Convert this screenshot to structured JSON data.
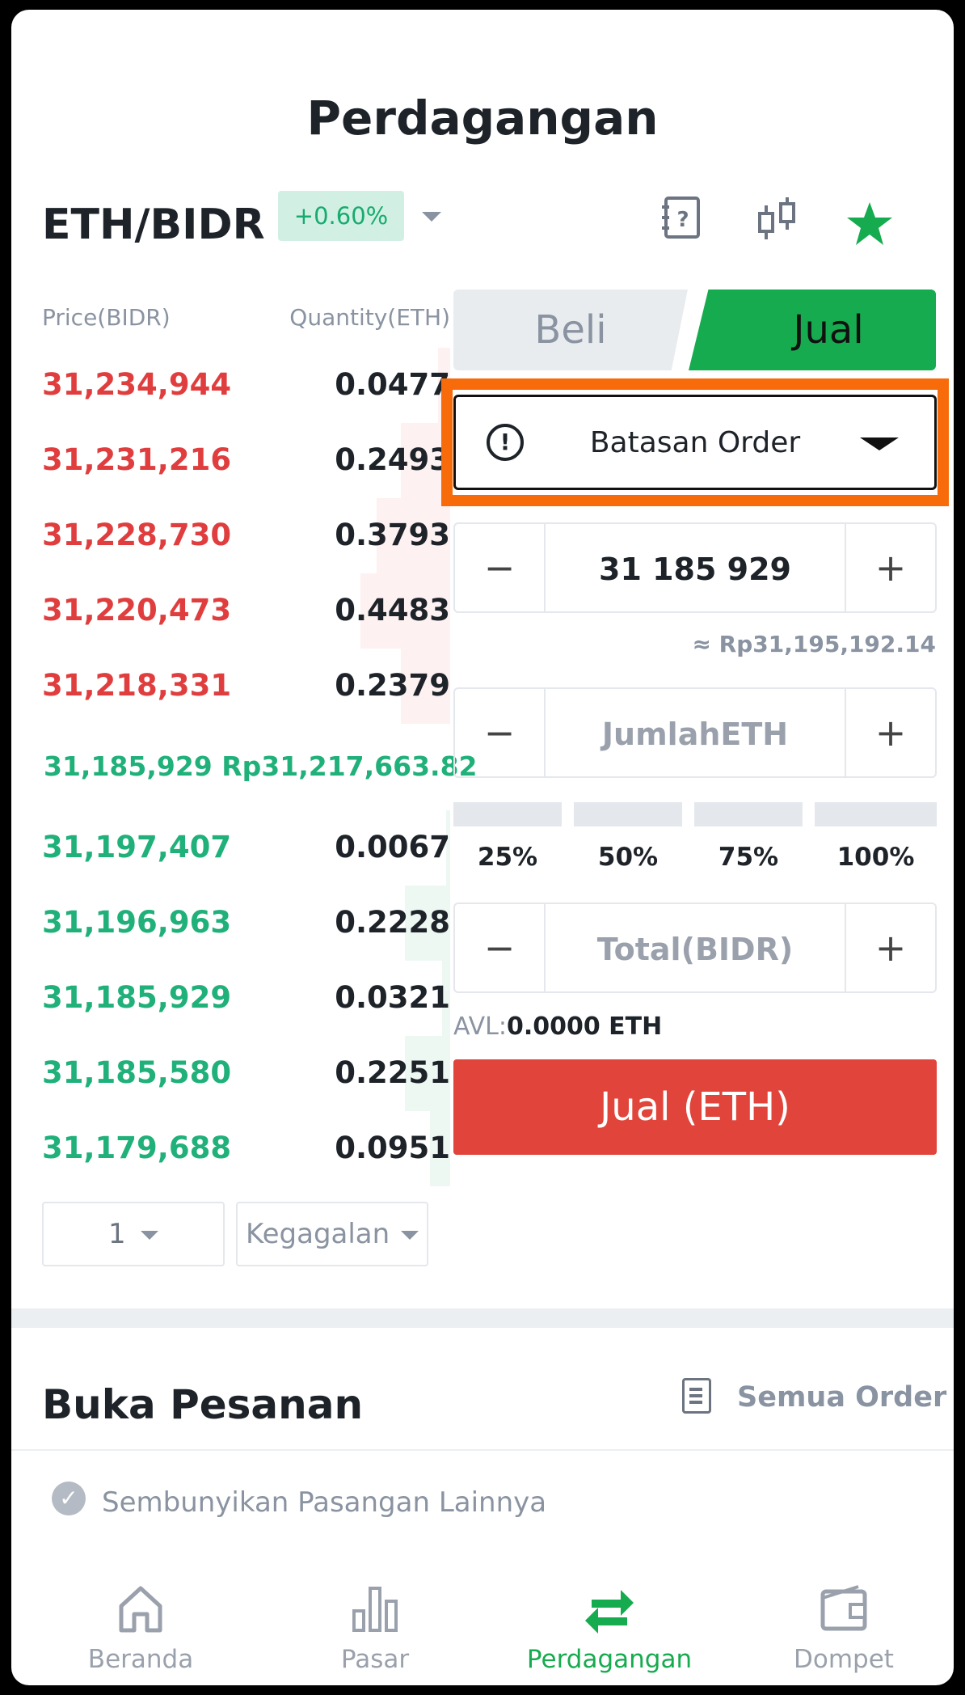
{
  "header": {
    "title": "Perdagangan",
    "pair": "ETH/BIDR",
    "change": "+0.60%",
    "icons": [
      "question-book-icon",
      "candlestick-icon",
      "star-icon"
    ]
  },
  "orderbook": {
    "price_header": "Price(BIDR)",
    "qty_header": "Quantity(ETH)",
    "asks": [
      {
        "price": "31,234,944",
        "qty": "0.0477",
        "depth": 0.03
      },
      {
        "price": "31,231,216",
        "qty": "0.2493",
        "depth": 0.12
      },
      {
        "price": "31,228,730",
        "qty": "0.3793",
        "depth": 0.18
      },
      {
        "price": "31,220,473",
        "qty": "0.4483",
        "depth": 0.22
      },
      {
        "price": "31,218,331",
        "qty": "0.2379",
        "depth": 0.12
      }
    ],
    "mid_price": "31,185,929",
    "mid_idr": "Rp31,217,663.82",
    "bids": [
      {
        "price": "31,197,407",
        "qty": "0.0067",
        "depth": 0.01
      },
      {
        "price": "31,196,963",
        "qty": "0.2228",
        "depth": 0.11
      },
      {
        "price": "31,185,929",
        "qty": "0.0321",
        "depth": 0.02
      },
      {
        "price": "31,185,580",
        "qty": "0.2251",
        "depth": 0.11
      },
      {
        "price": "31,179,688",
        "qty": "0.0951",
        "depth": 0.05
      }
    ],
    "precision": "1",
    "mode": "Kegagalan"
  },
  "trade": {
    "buy_tab": "Beli",
    "sell_tab": "Jual",
    "order_type": "Batasan Order",
    "price_value": "31 185 929",
    "price_approx": "≈ Rp31,195,192.14",
    "amount_placeholder": "JumlahETH",
    "percents": [
      "25%",
      "50%",
      "75%",
      "100%"
    ],
    "total_placeholder": "Total(BIDR)",
    "avl_label": "AVL:",
    "avl_value": "0.0000 ETH",
    "sell_button": "Jual (ETH)",
    "minus": "−",
    "plus": "+"
  },
  "open_orders": {
    "title": "Buka Pesanan",
    "all_orders": "Semua Order",
    "hide_pairs": "Sembunyikan Pasangan Lainnya"
  },
  "nav": {
    "items": [
      {
        "label": "Beranda",
        "icon": "home-icon"
      },
      {
        "label": "Pasar",
        "icon": "bar-chart-icon"
      },
      {
        "label": "Perdagangan",
        "icon": "swap-arrows-icon"
      },
      {
        "label": "Dompet",
        "icon": "wallet-icon"
      }
    ]
  },
  "colors": {
    "ask": "#e03e3e",
    "bid": "#20b07a",
    "sell": "#e0443a",
    "accent_green": "#17ab4f",
    "highlight": "#f76b0a"
  }
}
